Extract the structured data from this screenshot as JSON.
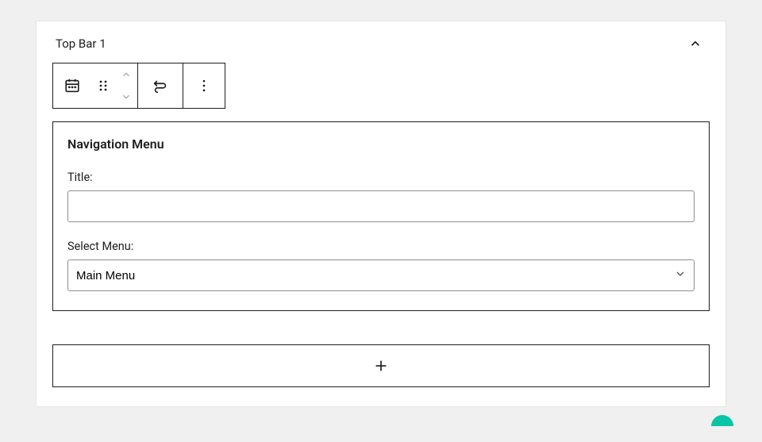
{
  "panel": {
    "title": "Top Bar 1"
  },
  "widget": {
    "heading": "Navigation Menu",
    "title_label": "Title:",
    "title_value": "",
    "select_label": "Select Menu:",
    "select_value": "Main Menu"
  },
  "icons": {
    "block_type": "calendar-icon",
    "drag": "drag-icon",
    "move_up": "chevron-up-icon",
    "move_down": "chevron-down-icon",
    "transform": "transform-icon",
    "more": "more-vertical-icon",
    "collapse": "chevron-up-icon",
    "add": "plus-icon",
    "select_caret": "chevron-down-icon"
  }
}
